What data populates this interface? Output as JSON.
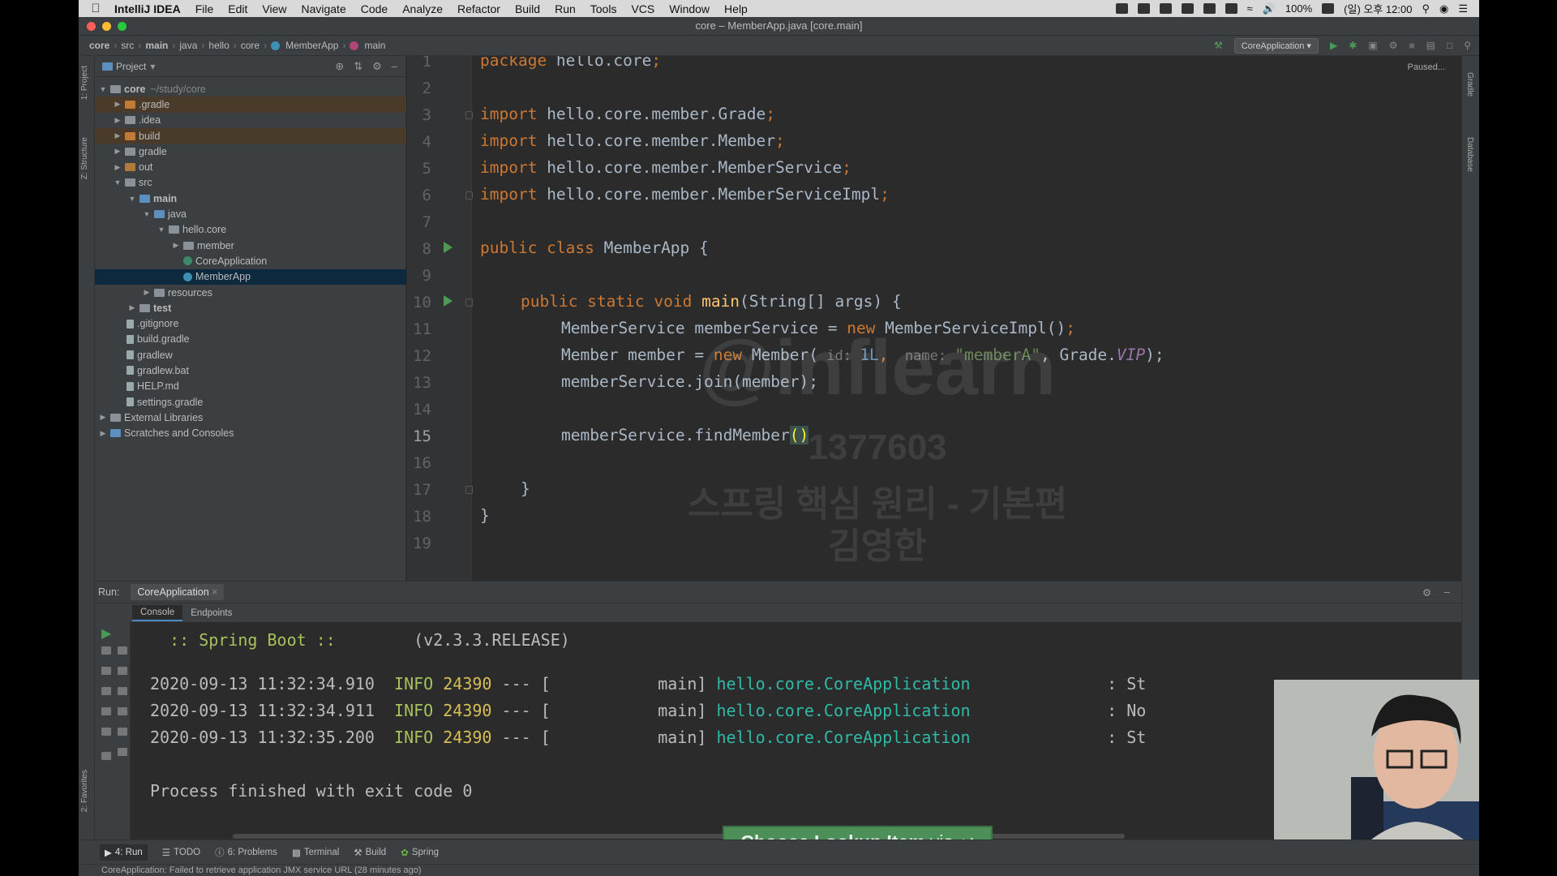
{
  "menubar": {
    "app": "IntelliJ IDEA",
    "items": [
      "File",
      "Edit",
      "View",
      "Navigate",
      "Code",
      "Analyze",
      "Refactor",
      "Build",
      "Run",
      "Tools",
      "VCS",
      "Window",
      "Help"
    ],
    "battery": "100%",
    "clock": "(일) 오후 12:00"
  },
  "window": {
    "title": "core – MemberApp.java [core.main]"
  },
  "breadcrumb": [
    "core",
    "src",
    "main",
    "java",
    "hello",
    "core",
    "MemberApp",
    "main"
  ],
  "toolbar": {
    "run_config": "CoreApplication"
  },
  "project": {
    "header": "Project",
    "tree": [
      {
        "label": "core",
        "note": "~/study/core"
      },
      {
        "label": ".gradle"
      },
      {
        "label": ".idea"
      },
      {
        "label": "build"
      },
      {
        "label": "gradle"
      },
      {
        "label": "out"
      },
      {
        "label": "src"
      },
      {
        "label": "main"
      },
      {
        "label": "java"
      },
      {
        "label": "hello.core"
      },
      {
        "label": "member"
      },
      {
        "label": "CoreApplication"
      },
      {
        "label": "MemberApp"
      },
      {
        "label": "resources"
      },
      {
        "label": "test"
      },
      {
        "label": ".gitignore"
      },
      {
        "label": "build.gradle"
      },
      {
        "label": "gradlew"
      },
      {
        "label": "gradlew.bat"
      },
      {
        "label": "HELP.md"
      },
      {
        "label": "settings.gradle"
      },
      {
        "label": "External Libraries"
      },
      {
        "label": "Scratches and Consoles"
      }
    ]
  },
  "side_tabs": {
    "project": "1: Project",
    "structure": "Z: Structure",
    "favorites": "2: Favorites",
    "gradle": "Gradle",
    "database": "Database"
  },
  "editor": {
    "paused": "Paused...",
    "line_numbers": [
      "1",
      "2",
      "3",
      "4",
      "5",
      "6",
      "7",
      "8",
      "9",
      "10",
      "11",
      "12",
      "13",
      "14",
      "15",
      "16",
      "17",
      "18",
      "19"
    ],
    "code": {
      "l1a": "package",
      "l1b": " hello.core",
      "l1c": ";",
      "imp": "import",
      "l3": " hello.core.member.Grade",
      "l4": " hello.core.member.Member",
      "l5": " hello.core.member.MemberService",
      "l6": " hello.core.member.MemberServiceImpl",
      "semi": ";",
      "l8a": "public class",
      "l8b": " MemberApp {",
      "l10a": "public static void",
      "l10b": "main",
      "l10c": "(String[] args) {",
      "l11a": "MemberService memberService = ",
      "l11b": "new",
      "l11c": " MemberServiceImpl()",
      "l12a": "Member member = ",
      "l12b": "new",
      "l12c": " Member(",
      "l12d": " id: ",
      "l12e": "1L",
      "l12f": ",",
      "l12g": "  name: ",
      "l12h": "\"memberA\"",
      "l12i": ", Grade.",
      "l12j": "VIP",
      "l12k": ");",
      "l13": "memberService.join(member);",
      "l15a": "memberService.findMember",
      "l15b": "(",
      "l15c": ")",
      "l17": "}",
      "l18": "}"
    },
    "watermark": {
      "brand": "@inflearn",
      "id": "1377603",
      "course": "스프링 핵심 원리 - 기본편",
      "author": "김영한"
    }
  },
  "run_panel": {
    "label": "Run:",
    "tab": "CoreApplication",
    "subtabs": [
      "Console",
      "Endpoints"
    ],
    "console": {
      "boot": ":: Spring Boot ::",
      "version": "(v2.3.3.RELEASE)",
      "logs": [
        {
          "time": "2020-09-13 11:32:34.910",
          "level": "INFO",
          "pid": "24390",
          "sep": "---",
          "bracket": "[",
          "thread": "main]",
          "cls": "hello.core.CoreApplication",
          "tail": ": St"
        },
        {
          "time": "2020-09-13 11:32:34.911",
          "level": "INFO",
          "pid": "24390",
          "sep": "---",
          "bracket": "[",
          "thread": "main]",
          "cls": "hello.core.CoreApplication",
          "tail": ": No"
        },
        {
          "time": "2020-09-13 11:32:35.200",
          "level": "INFO",
          "pid": "24390",
          "sep": "---",
          "bracket": "[",
          "thread": "main]",
          "cls": "hello.core.CoreApplication",
          "tail": ": St"
        }
      ],
      "exit": "Process finished with exit code 0"
    }
  },
  "lookup_hint": {
    "main": "Choose Lookup Item",
    "via": "via ↩"
  },
  "bottom_tabs": [
    "4: Run",
    "TODO",
    "6: Problems",
    "Terminal",
    "Build",
    "Spring"
  ],
  "status": "CoreApplication: Failed to retrieve application JMX service URL (28 minutes ago)",
  "colors": {
    "keyword": "#cc7832",
    "string": "#6a8759",
    "number": "#6897bb",
    "function": "#ffc66d",
    "selection": "#0d293e",
    "lookup": "#4c8f58"
  }
}
